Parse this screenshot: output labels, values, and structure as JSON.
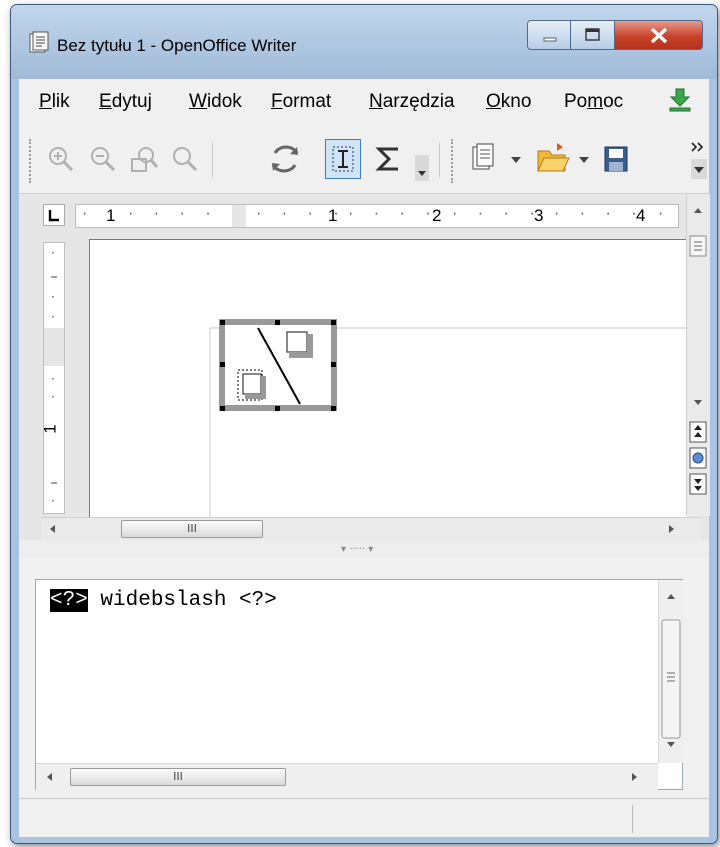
{
  "window": {
    "title": "Bez tytułu 1 - OpenOffice Writer",
    "controls": [
      "minimize",
      "maximize",
      "close"
    ]
  },
  "menu": {
    "items": [
      {
        "pre": "",
        "u": "P",
        "post": "lik"
      },
      {
        "pre": "",
        "u": "E",
        "post": "dytuj"
      },
      {
        "pre": "",
        "u": "W",
        "post": "idok"
      },
      {
        "pre": "",
        "u": "F",
        "post": "ormat"
      },
      {
        "pre": "",
        "u": "N",
        "post": "arzędzia"
      },
      {
        "pre": "",
        "u": "O",
        "post": "kno"
      },
      {
        "pre": "Po",
        "u": "m",
        "post": "oc"
      }
    ],
    "trailing_icon": "download-icon"
  },
  "toolbar": {
    "icons": [
      "zoom-in-icon",
      "zoom-out-icon",
      "zoom-100-icon",
      "zoom-page-icon",
      "update-icon",
      "formula-cursor-icon",
      "sum-icon",
      "dropdown-arrow-icon",
      "new-document-icon",
      "open-folder-icon",
      "save-icon",
      "overflow-icon"
    ]
  },
  "ruler": {
    "left_num": "1",
    "nums": [
      "1",
      "2",
      "3",
      "4"
    ],
    "vertical_num": "1"
  },
  "formula": {
    "placeholder_left": "<?>",
    "rest": " widebslash <?>"
  },
  "colors": {
    "title_gradient_top": "#c2d6ec",
    "close_red": "#c8432c",
    "selection_blue": "#3d7fc2"
  }
}
